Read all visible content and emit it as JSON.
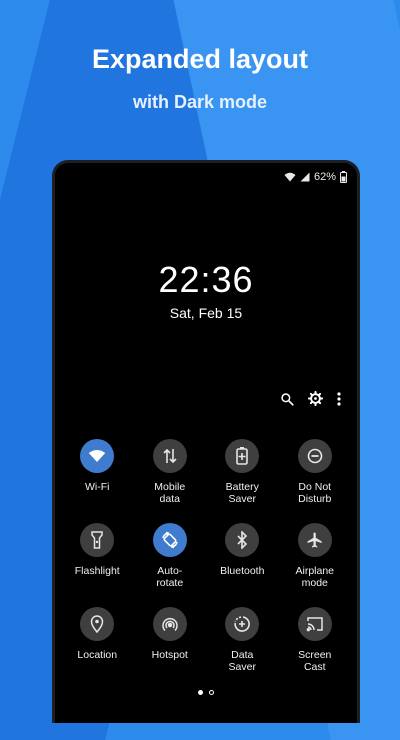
{
  "promo": {
    "headline": "Expanded layout",
    "subline": "with Dark mode"
  },
  "status_bar": {
    "battery_text": "62%"
  },
  "lock": {
    "time": "22:36",
    "date": "Sat, Feb 15"
  },
  "actions": [
    "search-icon",
    "gear-icon",
    "more-vert-icon"
  ],
  "tiles": [
    {
      "label": "Wi-Fi",
      "icon": "wifi-icon",
      "active": true
    },
    {
      "label": "Mobile\ndata",
      "icon": "mobile-data-icon",
      "active": false
    },
    {
      "label": "Battery\nSaver",
      "icon": "battery-saver-icon",
      "active": false
    },
    {
      "label": "Do Not\nDisturb",
      "icon": "do-not-disturb-icon",
      "active": false
    },
    {
      "label": "Flashlight",
      "icon": "flashlight-icon",
      "active": false
    },
    {
      "label": "Auto-\nrotate",
      "icon": "auto-rotate-icon",
      "active": true
    },
    {
      "label": "Bluetooth",
      "icon": "bluetooth-icon",
      "active": false
    },
    {
      "label": "Airplane\nmode",
      "icon": "airplane-icon",
      "active": false
    },
    {
      "label": "Location",
      "icon": "location-icon",
      "active": false
    },
    {
      "label": "Hotspot",
      "icon": "hotspot-icon",
      "active": false
    },
    {
      "label": "Data\nSaver",
      "icon": "data-saver-icon",
      "active": false
    },
    {
      "label": "Screen\nCast",
      "icon": "cast-icon",
      "active": false
    }
  ],
  "pager": {
    "pages": 2,
    "current": 1
  },
  "colors": {
    "background": "#2d8bee",
    "tile_active": "#3f7ccd",
    "tile_inactive": "#3f3f3f",
    "screen": "#000000"
  }
}
